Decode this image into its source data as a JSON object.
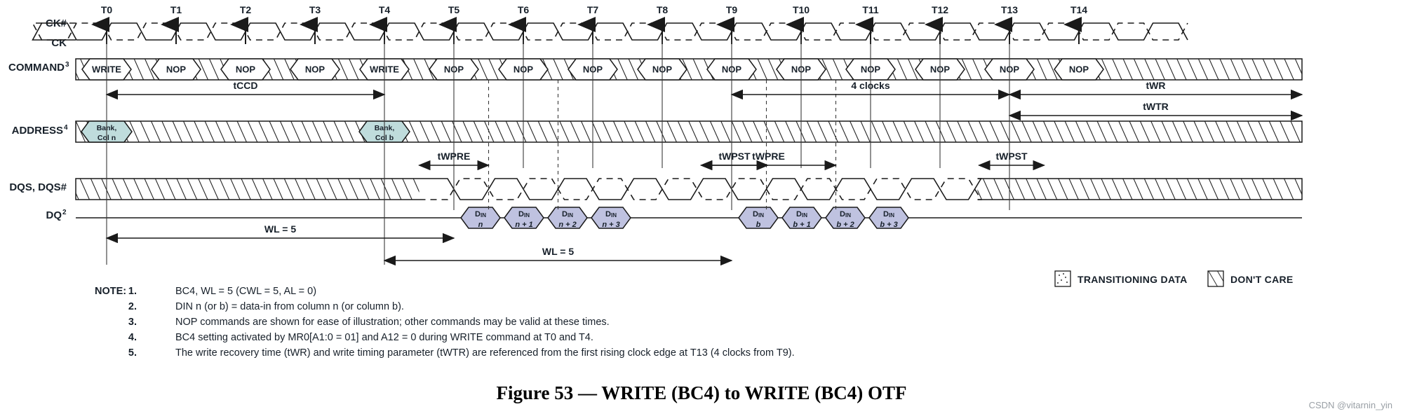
{
  "figure": {
    "caption": "Figure 53 — WRITE (BC4) to WRITE (BC4) OTF",
    "watermark": "CSDN @vitarnin_yin"
  },
  "signals": {
    "ck_hash": "CK#",
    "ck": "CK",
    "command": "COMMAND",
    "command_sup": "3",
    "address": "ADDRESS",
    "address_sup": "4",
    "dqs": "DQS, DQS#",
    "dq": "DQ",
    "dq_sup": "2"
  },
  "clock_ticks": [
    "T0",
    "T1",
    "T2",
    "T3",
    "T4",
    "T5",
    "T6",
    "T7",
    "T8",
    "T9",
    "T10",
    "T11",
    "T12",
    "T13",
    "T14"
  ],
  "commands": [
    {
      "tick": "T0",
      "label": "WRITE"
    },
    {
      "tick": "T1",
      "label": "NOP"
    },
    {
      "tick": "T2",
      "label": "NOP"
    },
    {
      "tick": "T3",
      "label": "NOP"
    },
    {
      "tick": "T4",
      "label": "WRITE"
    },
    {
      "tick": "T5",
      "label": "NOP"
    },
    {
      "tick": "T6",
      "label": "NOP"
    },
    {
      "tick": "T7",
      "label": "NOP"
    },
    {
      "tick": "T8",
      "label": "NOP"
    },
    {
      "tick": "T9",
      "label": "NOP"
    },
    {
      "tick": "T10",
      "label": "NOP"
    },
    {
      "tick": "T11",
      "label": "NOP"
    },
    {
      "tick": "T12",
      "label": "NOP"
    },
    {
      "tick": "T13",
      "label": "NOP"
    },
    {
      "tick": "T14",
      "label": "NOP"
    }
  ],
  "address_cells": [
    {
      "tick": "T0",
      "line1": "Bank,",
      "line2": "Col n"
    },
    {
      "tick": "T4",
      "line1": "Bank,",
      "line2": "Col b"
    }
  ],
  "dq_cells": [
    {
      "top": "DIN",
      "bottom": "n"
    },
    {
      "top": "DIN",
      "bottom": "n + 1"
    },
    {
      "top": "DIN",
      "bottom": "n + 2"
    },
    {
      "top": "DIN",
      "bottom": "n + 3"
    },
    {
      "top": "DIN",
      "bottom": "b"
    },
    {
      "top": "DIN",
      "bottom": "b + 1"
    },
    {
      "top": "DIN",
      "bottom": "b + 2"
    },
    {
      "top": "DIN",
      "bottom": "b + 3"
    }
  ],
  "timing_markers": {
    "tccd": "tCCD",
    "four_clocks": "4 clocks",
    "twr": "tWR",
    "twtr": "tWTR",
    "twpre_1": "tWPRE",
    "twpst_1": "tWPST",
    "twpre_2": "tWPRE",
    "twpst_2": "tWPST",
    "wl_1": "WL = 5",
    "wl_2": "WL = 5"
  },
  "legend": [
    {
      "icon": "transitioning-data-swatch",
      "label": "TRANSITIONING DATA"
    },
    {
      "icon": "dont-care-swatch",
      "label": "DON'T CARE"
    }
  ],
  "notes": {
    "header": "NOTE:",
    "items": [
      {
        "num": "1.",
        "text": "BC4, WL = 5 (CWL = 5, AL = 0)"
      },
      {
        "num": "2.",
        "text": "DIN n (or b)  = data-in from column n (or column b)."
      },
      {
        "num": "3.",
        "text": "NOP commands are shown for ease of illustration; other commands may be valid at these times."
      },
      {
        "num": "4.",
        "text": "BC4 setting activated by MR0[A1:0 = 01] and A12 = 0 during WRITE command at T0 and T4."
      },
      {
        "num": "5.",
        "text": "The write recovery time (tWR) and write timing parameter (tWTR) are referenced from the first rising clock edge at T13 (4 clocks from T9)."
      }
    ]
  },
  "colors": {
    "address_fill": "#bfdcdc",
    "dq_fill": "#bfc2e0",
    "ink": "#1a1a1a",
    "watermark": "#9aa0a6"
  }
}
